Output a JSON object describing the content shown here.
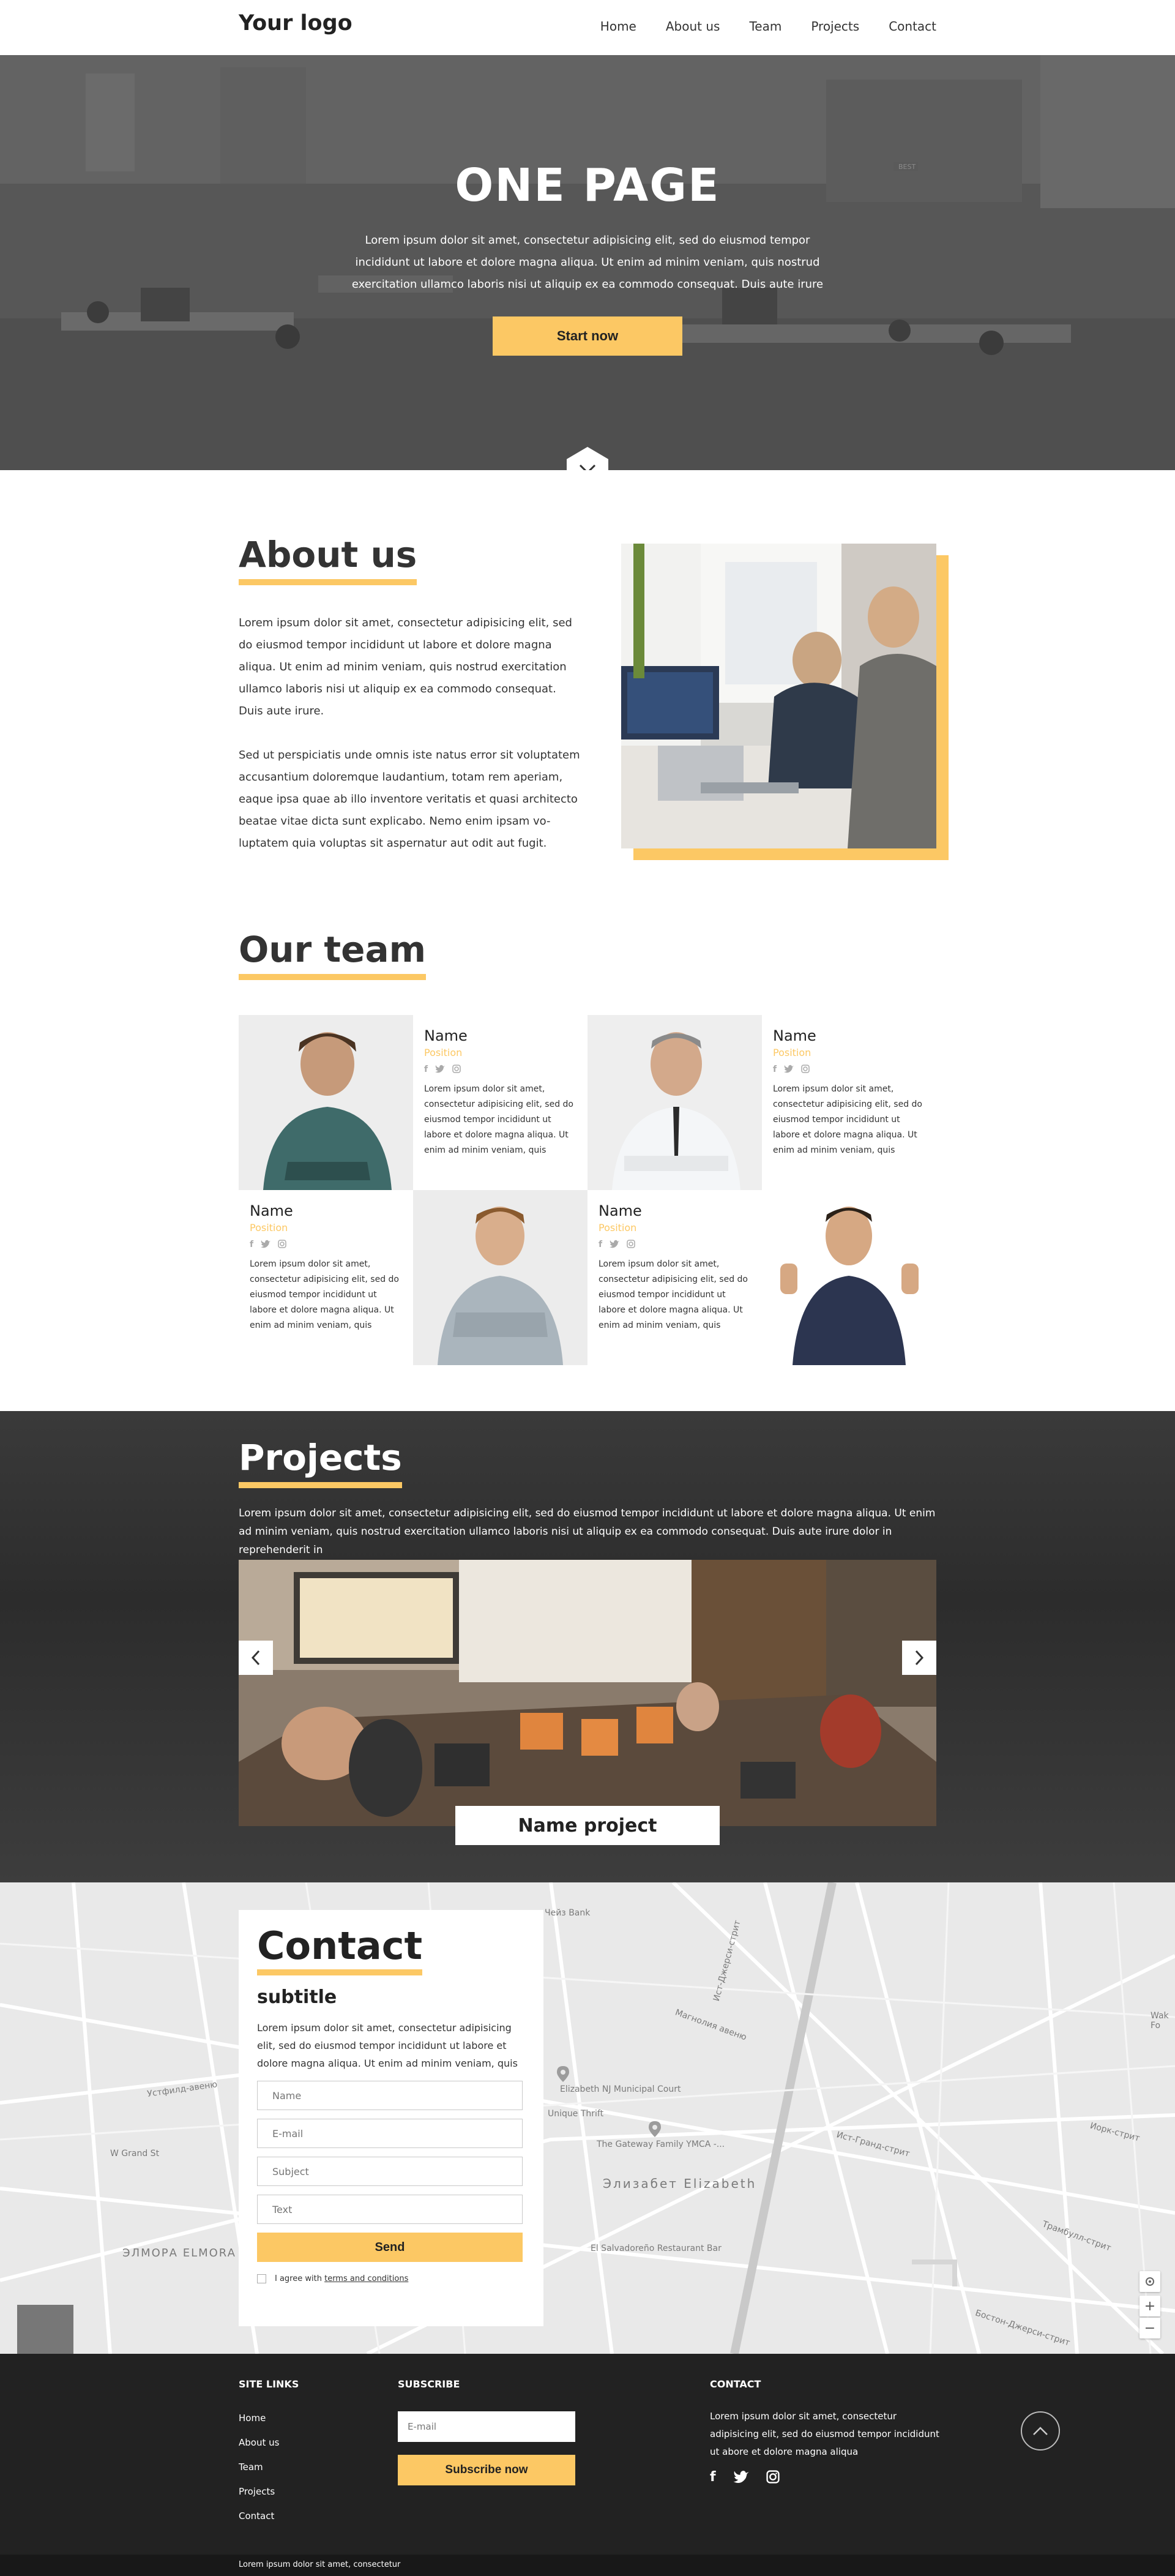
{
  "header": {
    "logo": "Your logo",
    "nav": [
      "Home",
      "About us",
      "Team",
      "Projects",
      "Contact"
    ]
  },
  "hero": {
    "title": "ONE PAGE",
    "text": "Lorem ipsum dolor sit amet, consectetur adipisicing elit, sed do eiusmod tempor incididunt ut labore et dolore magna aliqua. Ut enim ad minim veniam, quis nostrud exercitation ullamco laboris nisi ut aliquip ex ea commodo consequat. Duis aute irure",
    "button": "Start now",
    "sign": "BEST"
  },
  "about": {
    "title": "About us",
    "p1": "Lorem ipsum dolor sit amet, consectetur adipisicing elit, sed do eiusmod tempor incididunt ut labore et dolore magna aliqua. Ut enim ad minim veniam, quis nostrud exercitation ullamco laboris nisi ut aliquip ex ea commodo consequat. Duis aute irure.",
    "p2": "Sed ut perspiciatis unde omnis iste natus error sit voluptatem accusantium doloremque laudantium, totam rem aperiam, eaque ipsa quae ab illo inventore veritatis et quasi architecto beatae vitae dicta sunt explicabo. Nemo enim ipsam vo-luptatem quia voluptas sit aspernatur aut odit aut fugit."
  },
  "team": {
    "title": "Our team",
    "members": [
      {
        "name": "Name",
        "position": "Position",
        "text": "Lorem ipsum dolor sit amet, consectetur adipisicing elit, sed do eiusmod tempor incididunt ut labore et dolore magna aliqua. Ut enim ad minim veniam, quis"
      },
      {
        "name": "Name",
        "position": "Position",
        "text": "Lorem ipsum dolor sit amet, consectetur adipisicing elit, sed do eiusmod tempor incididunt ut labore et dolore magna aliqua. Ut enim ad minim veniam, quis"
      },
      {
        "name": "Name",
        "position": "Position",
        "text": "Lorem ipsum dolor sit amet, consectetur adipisicing elit, sed do eiusmod tempor incididunt ut labore et dolore magna aliqua. Ut enim ad minim veniam, quis"
      },
      {
        "name": "Name",
        "position": "Position",
        "text": "Lorem ipsum dolor sit amet, consectetur adipisicing elit, sed do eiusmod tempor incididunt ut labore et dolore magna aliqua. Ut enim ad minim veniam, quis"
      }
    ]
  },
  "projects": {
    "title": "Projects",
    "text": "Lorem ipsum dolor sit amet, consectetur adipisicing elit, sed do eiusmod tempor incididunt ut labore et dolore magna aliqua. Ut enim ad minim veniam, quis nostrud exercitation ullamco laboris nisi ut aliquip ex ea commodo consequat. Duis aute irure dolor in reprehenderit in",
    "project_name": "Name project"
  },
  "contact": {
    "title": "Contact",
    "subtitle": "subtitle",
    "text": "Lorem ipsum dolor sit amet, consectetur adipisicing elit, sed do eiusmod tempor incididunt ut labore et dolore magna aliqua. Ut enim ad minim veniam, quis",
    "placeholders": {
      "name": "Name",
      "email": "E-mail",
      "subject": "Subject",
      "text": "Text"
    },
    "send": "Send",
    "agree_prefix": "I agree with",
    "agree_link": "terms and conditions"
  },
  "map": {
    "labels": [
      "Elizabeth NJ Municipal Court",
      "The Gateway Family YMCA -...",
      "Элизабет Elizabeth",
      "El Salvadoreño Restaurant Bar",
      "ЭЛМОРА ELMORA",
      "Unique Thrift",
      "Чейз Bank",
      "Ист-Джерси-стрит",
      "Ист-Гранд-стрит",
      "Магнолия авеню",
      "W Grand St",
      "Устфилд-авеню",
      "Иорк-стрит",
      "Бостон-Джерси-стрит",
      "Трамбулл-стрит",
      "Wak Fo"
    ],
    "zoom_in": "+",
    "zoom_out": "−"
  },
  "footer": {
    "site_links_head": "SITE LINKS",
    "links": [
      "Home",
      "About us",
      "Team",
      "Projects",
      "Contact"
    ],
    "subscribe_head": "SUBSCRIBE",
    "email_placeholder": "E-mail",
    "subscribe_button": "Subscribe now",
    "contact_head": "CONTACT",
    "contact_text": "Lorem ipsum dolor sit amet, consectetur adipisicing elit, sed do eiusmod tempor incididunt ut abore et dolore magna aliqua",
    "copyright": "Lorem ipsum dolor sit amet, consectetur"
  },
  "colors": {
    "accent": "#fcc864",
    "dark": "#222222",
    "hero_overlay": "#555555"
  }
}
